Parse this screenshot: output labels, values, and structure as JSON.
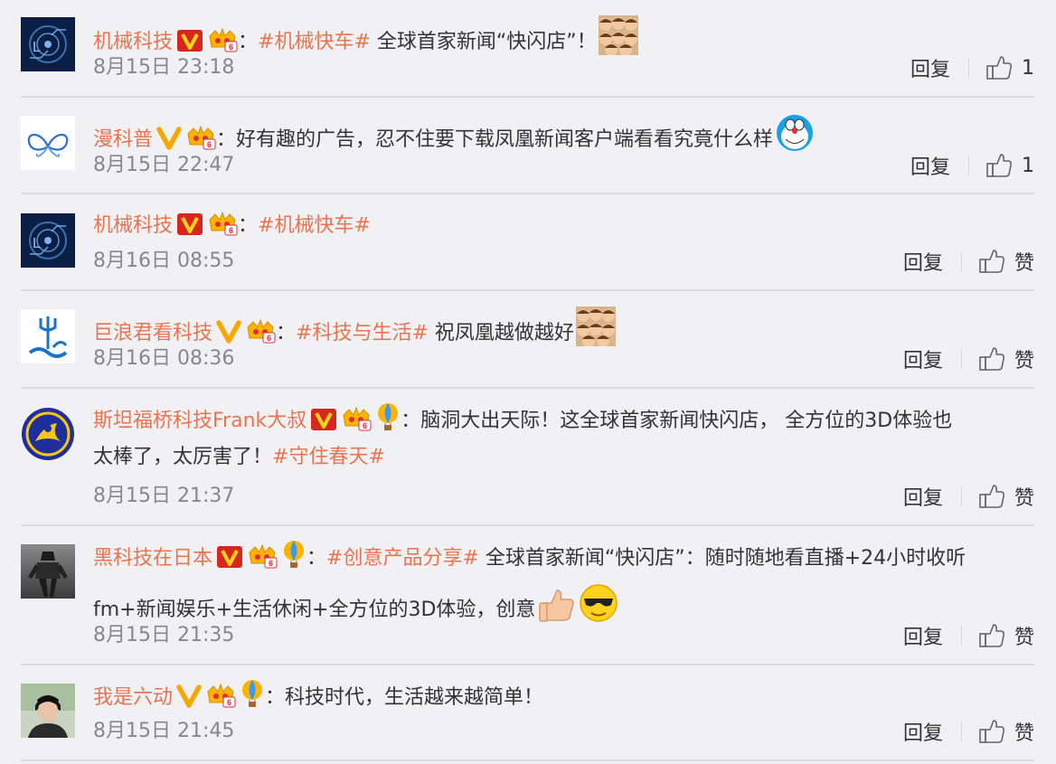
{
  "colors": {
    "accent": "#eb7350",
    "time": "#888888",
    "background": "#f1f1f3",
    "divider": "#dcdcdc"
  },
  "comments": [
    {
      "username": "机械科技",
      "avatar_icon": "gear-circuit-avatar",
      "badges": [
        "verified-red-v-icon",
        "vip-crown-icon"
      ],
      "lines": [
        {
          "topic": "#机械快车#",
          "text": " 全球首家新闻“快闪店”！",
          "emoji": "crowd-emoji"
        }
      ],
      "time": "8月15日 23:18",
      "reply_label": "回复",
      "like_label": "1"
    },
    {
      "username": "漫科普",
      "avatar_icon": "butterfly-avatar",
      "badges": [
        "verified-yellow-v-icon",
        "vip-crown-icon"
      ],
      "lines": [
        {
          "topic": "",
          "text": "好有趣的广告，忍不住要下载凤凰新闻客户端看看究竟什么样",
          "emoji": "doraemon-emoji"
        }
      ],
      "time": "8月15日 22:47",
      "reply_label": "回复",
      "like_label": "1"
    },
    {
      "username": "机械科技",
      "avatar_icon": "gear-circuit-avatar",
      "badges": [
        "verified-red-v-icon",
        "vip-crown-icon"
      ],
      "lines": [
        {
          "topic": "#机械快车#",
          "text": "",
          "emoji": ""
        }
      ],
      "time": "8月16日 08:55",
      "reply_label": "回复",
      "like_label": "赞"
    },
    {
      "username": "巨浪君看科技",
      "avatar_icon": "trident-wave-avatar",
      "badges": [
        "verified-yellow-v-icon",
        "vip-crown-icon"
      ],
      "lines": [
        {
          "topic": "#科技与生活#",
          "text": " 祝凤凰越做越好",
          "emoji": "crowd-emoji"
        }
      ],
      "time": "8月16日 08:36",
      "reply_label": "回复",
      "like_label": "赞"
    },
    {
      "username": "斯坦福桥科技Frank大叔",
      "avatar_icon": "blue-emblem-avatar",
      "badges": [
        "verified-red-v-icon",
        "vip-crown-icon",
        "balloon-icon"
      ],
      "lines": [
        {
          "topic": "",
          "text": "脑洞大出天际！这全球首家新闻快闪店， 全方位的3D体验也",
          "emoji": ""
        },
        {
          "topic": "",
          "text": "太棒了，太厉害了！",
          "topic_after": "#守住春天#",
          "emoji": ""
        }
      ],
      "time": "8月15日 21:37",
      "reply_label": "回复",
      "like_label": "赞"
    },
    {
      "username": "黑科技在日本",
      "avatar_icon": "robot-avatar",
      "badges": [
        "verified-red-v-icon",
        "vip-crown-icon",
        "balloon-icon"
      ],
      "lines": [
        {
          "topic": "#创意产品分享#",
          "text": "  全球首家新闻“快闪店”：随时随地看直播+24小时收听",
          "emoji": ""
        },
        {
          "topic": "",
          "text": "fm+新闻娱乐+生活休闲+全方位的3D体验，创意",
          "emoji": "thumbs-up-emoji",
          "emoji2": "cool-sunglasses-emoji"
        }
      ],
      "time": "8月15日 21:35",
      "reply_label": "回复",
      "like_label": "赞"
    },
    {
      "username": "我是六动",
      "avatar_icon": "person-photo-avatar",
      "badges": [
        "verified-yellow-v-icon",
        "vip-crown-icon",
        "balloon-icon"
      ],
      "lines": [
        {
          "topic": "",
          "text": "科技时代，生活越来越简单！",
          "emoji": ""
        }
      ],
      "time": "8月15日 21:45",
      "reply_label": "回复",
      "like_label": "赞"
    }
  ]
}
